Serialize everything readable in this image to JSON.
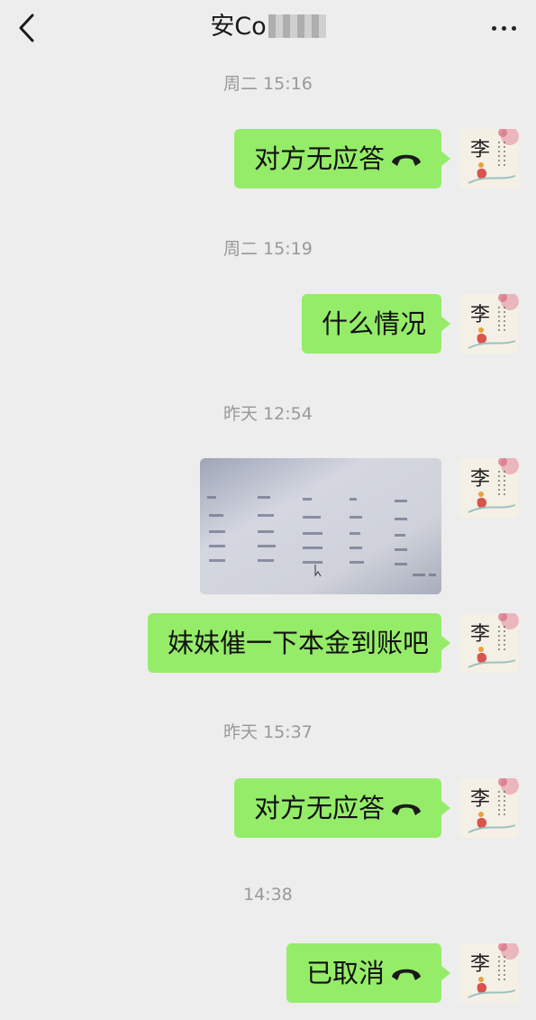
{
  "header": {
    "title": "安Co",
    "back_icon": "chevron-left-icon",
    "more_icon": "more-dots-icon"
  },
  "messages": [
    {
      "time": "周二 15:16",
      "text": "对方无应答",
      "type": "call"
    },
    {
      "time": "周二 15:19",
      "text": "什么情况",
      "type": "text"
    },
    {
      "time": "昨天 12:54",
      "type": "image"
    },
    {
      "text": "妹妹催一下本金到账吧",
      "type": "text"
    },
    {
      "time": "昨天 15:37",
      "text": "对方无应答",
      "type": "call"
    },
    {
      "time": "14:38",
      "text": "已取消",
      "type": "call"
    }
  ],
  "avatar": {
    "char": "李"
  },
  "colors": {
    "bubble": "#95ec69",
    "background": "#ededed",
    "timestamp": "#999999"
  }
}
